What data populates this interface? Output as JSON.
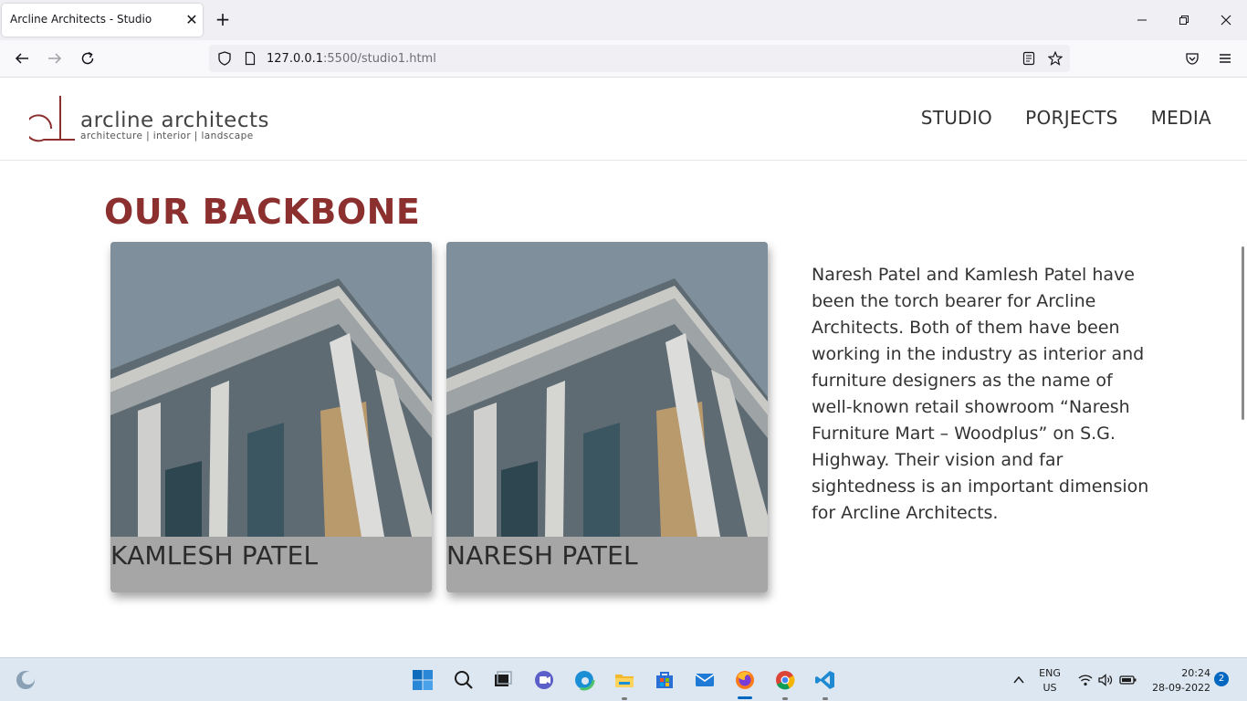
{
  "browser": {
    "tab_title": "Arcline Architects - Studio",
    "tab_close": "✕",
    "new_tab": "+",
    "url_host": "127.0.0.1",
    "url_rest": ":5500/studio1.html"
  },
  "site": {
    "logo_name": "arcline architects",
    "logo_tagline": "architecture | interior | landscape",
    "nav": [
      "STUDIO",
      "PORJECTS",
      "MEDIA"
    ]
  },
  "main": {
    "title": "OUR BACKBONE",
    "cards": [
      {
        "name": "KAMLESH PATEL"
      },
      {
        "name": "NARESH PATEL"
      }
    ],
    "about": "Naresh Patel and Kamlesh Patel have been the torch bearer for Arcline Architects. Both of them have been working in the industry as interior and furniture designers as the name of well-known retail showroom “Naresh Furniture Mart – Woodplus” on S.G. Highway. Their vision and far sightedness is an important dimension for Arcline Architects."
  },
  "taskbar": {
    "lang_top": "ENG",
    "lang_bottom": "US",
    "time": "20:24",
    "date": "28-09-2022",
    "notifications": "2"
  },
  "colors": {
    "accent_title": "#8b2f2f",
    "card_bg": "#a6a6a6",
    "taskbar_bg": "#dde7f1"
  }
}
